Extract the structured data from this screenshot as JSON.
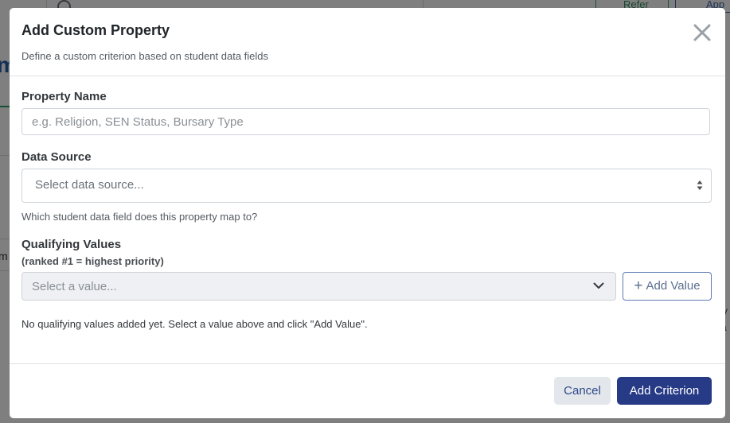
{
  "background": {
    "refer_label": "Refer",
    "app_label": "App",
    "letter_fragment": "m",
    "letter_fragment_2": "m",
    "right_fragment_1": "V",
    "right_fragment_2": "a"
  },
  "modal": {
    "title": "Add Custom Property",
    "subtitle": "Define a custom criterion based on student data fields",
    "close_icon": "close-icon"
  },
  "property_name": {
    "label": "Property Name",
    "value": "",
    "placeholder": "e.g. Religion, SEN Status, Bursary Type"
  },
  "data_source": {
    "label": "Data Source",
    "selected": "Select data source...",
    "hint": "Which student data field does this property map to?"
  },
  "qualifying_values": {
    "label": "Qualifying Values",
    "sublabel": "(ranked #1 = highest priority)",
    "select_placeholder": "Select a value...",
    "add_button": "Add Value",
    "empty_message": "No qualifying values added yet. Select a value above and click \"Add Value\"."
  },
  "footer": {
    "cancel": "Cancel",
    "submit": "Add Criterion"
  },
  "colors": {
    "primary": "#263a86",
    "backdrop": "rgba(0,0,0,0.5)"
  }
}
